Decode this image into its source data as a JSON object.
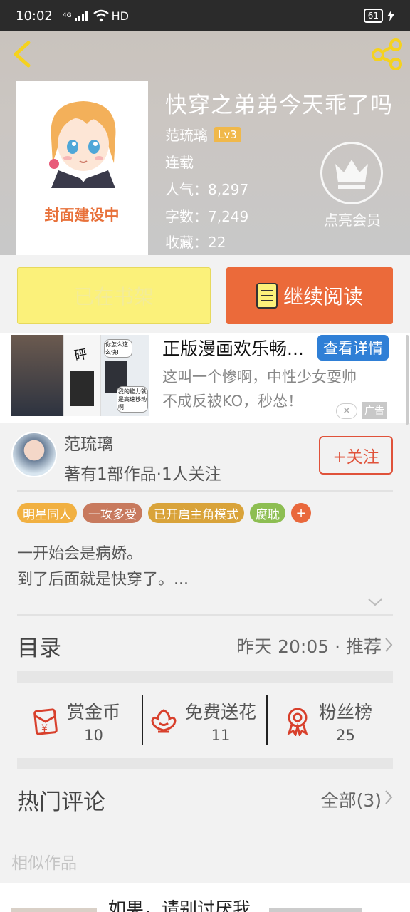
{
  "status_bar": {
    "time": "10:02",
    "network": "4G",
    "hd": "HD",
    "battery": "61"
  },
  "header": {
    "title": "快穿之弟弟今天乖了吗",
    "author": "范琉璃",
    "level": "Lv3",
    "status": "连载",
    "popularity": "人气：8,297",
    "word_count": "字数：7,249",
    "favorites": "收藏：22",
    "cover_text": "封面建设中",
    "vip_label": "点亮会员"
  },
  "actions": {
    "shelf": "已在书架",
    "read": "继续阅读"
  },
  "ad": {
    "title": "正版漫画欢乐畅...",
    "button": "查看详情",
    "desc_line1": "这叫一个惨啊，中性少女耍帅",
    "desc_line2": "不成反被KO，秒怂！",
    "close": "✕",
    "tag": "广告",
    "panel_texts": [
      "你怎么这么快!",
      "我的能力就是高速移动啊",
      "砰"
    ]
  },
  "author_card": {
    "name": "范琉璃",
    "stats": "著有1部作品·1人关注",
    "follow": "+关注"
  },
  "tags": [
    {
      "label": "明星同人",
      "color": "#f1b041"
    },
    {
      "label": "一攻多受",
      "color": "#c87a5e"
    },
    {
      "label": "已开启主角模式",
      "color": "#d9a33a"
    },
    {
      "label": "腐耽",
      "color": "#8dbe52"
    }
  ],
  "tag_more": "+",
  "description": {
    "line1": "一开始会是病娇。",
    "line2": "到了后面就是快穿了。..."
  },
  "catalog": {
    "title": "目录",
    "info": "昨天 20:05 · 推荐"
  },
  "rewards": [
    {
      "label": "赏金币",
      "count": "10",
      "icon": "coin-envelope-icon"
    },
    {
      "label": "免费送花",
      "count": "11",
      "icon": "flower-icon"
    },
    {
      "label": "粉丝榜",
      "count": "25",
      "icon": "medal-icon"
    }
  ],
  "comments": {
    "title": "热门评论",
    "all": "全部(3)"
  },
  "similar": {
    "title": "相似作品",
    "first_title": "如果，请别讨厌我"
  },
  "colors": {
    "accent": "#eb6a3a",
    "follow": "#e0523a",
    "shelf": "#fbf17a",
    "ad_button": "#2f7fd6"
  }
}
